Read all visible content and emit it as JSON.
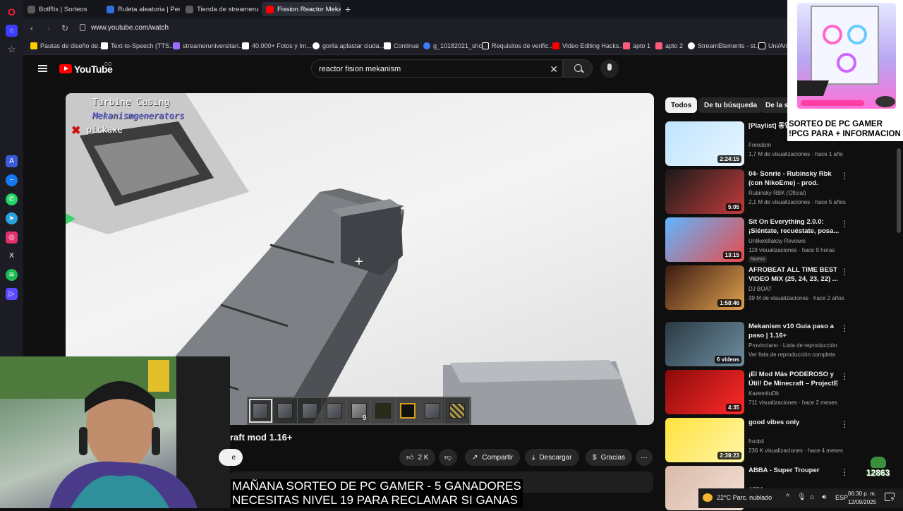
{
  "browser": {
    "tabs": [
      {
        "label": "BotRix | Sorteos",
        "color": "#5a5a5a"
      },
      {
        "label": "Ruleta aleatoria | Personal",
        "color": "#2f6fe0"
      },
      {
        "label": "Tienda de streameruniver",
        "color": "#5a5a5a"
      },
      {
        "label": "Fission Reactor Mekan",
        "color": "#ff0000"
      }
    ],
    "new_tab": "+",
    "url": "www.youtube.com/watch",
    "bookmarks": [
      {
        "label": "Pautas de diseño de...",
        "color": "#ffcc00"
      },
      {
        "label": "Text-to-Speech (TTS...",
        "color": "#ffffff"
      },
      {
        "label": "streameruniversitari...",
        "color": "#9b6bff"
      },
      {
        "label": "40.000+ Fotos y Im...",
        "color": "#ffffff"
      },
      {
        "label": "gorila aplastar ciuda...",
        "color": "#ffffff"
      },
      {
        "label": "Continue",
        "color": "#ffffff"
      },
      {
        "label": "g_10182021_shcc",
        "color": "#3d7bff"
      },
      {
        "label": "Requisitos de verific...",
        "color": "#ffffff"
      },
      {
        "label": "Video Editing Hacks...",
        "color": "#ff0000"
      },
      {
        "label": "apto 1",
        "color": "#ff5a7a"
      },
      {
        "label": "apto 2",
        "color": "#ff5a7a"
      },
      {
        "label": "StreamElements - st...",
        "color": "#ffffff"
      },
      {
        "label": "Uni/Ari",
        "color": "#ffffff"
      }
    ]
  },
  "youtube": {
    "logo_text": "YouTube",
    "country": "CO",
    "search_value": "reactor fision mekanism",
    "video_title": "raft mod 1.16+",
    "subscribe_label": "e",
    "actions": {
      "likes": "2 K",
      "share": "Compartir",
      "download": "Descargar",
      "thanks": "Gracias",
      "more": "···"
    },
    "chips": [
      "Todos",
      "De tu búsqueda",
      "De la se"
    ]
  },
  "game_overlay": {
    "title": "Turbine Casing",
    "subtitle": "Mekanismgenerators",
    "tool": "pickaxe",
    "hotbar_count": "9"
  },
  "recommendations": [
    {
      "title": "[Playlist] 동영 모음 2024 V",
      "channel": "Freedom",
      "meta": "1,7 M de visualizaciones · hace 1 año",
      "duration": "2:24:15",
      "color_a": "#bfe4ff",
      "color_b": "#e8f6ff"
    },
    {
      "title": "04- Sonrie - Rubinsky Rbk (con NikoEme) - prod. Nikoeme. ...",
      "channel": "Rubinsky RBK (Oficial)",
      "meta": "2,1 M de visualizaciones · hace 5 años",
      "duration": "5:05",
      "color_a": "#1a1a1a",
      "color_b": "#c23b3b"
    },
    {
      "title": "Sit On Everything 2.0.0: ¡Siéntate, recuéstate, posa... e...",
      "channel": "Unlikekillakay Reviews",
      "meta": "119 visualizaciones · hace 9 horas",
      "duration": "13:15",
      "badge": "Nuevo",
      "color_a": "#5fb6ff",
      "color_b": "#e84b4b"
    },
    {
      "title": "AFROBEAT ALL TIME BEST VIDEO MIX (25, 24, 23, 22) ...",
      "channel": "DJ BOAT",
      "meta": "39 M de visualizaciones · hace 2 años",
      "duration": "1:58:46",
      "color_a": "#3a1a10",
      "color_b": "#e0a050"
    },
    {
      "title": "Mekanism v10 Guia paso a paso | 1.16+",
      "channel": "Provinciano · Lista de reproducción",
      "meta": "Ver lista de reproducción completa",
      "duration": "6 videos",
      "color_a": "#2b3a44",
      "color_b": "#6d8ea0"
    },
    {
      "title": "¡El Mod Más PODEROSO y Útil! De Minecraft – ProjectE",
      "channel": "KazemitoDk",
      "meta": "711 visualizaciones · hace 2 meses",
      "duration": "4:35",
      "color_a": "#8a0a0a",
      "color_b": "#ff2a2a"
    },
    {
      "title": "good vibes only",
      "channel": "froobii",
      "meta": "236 K visualizaciones · hace 4 meses",
      "duration": "2:38:23",
      "color_a": "#ffe23d",
      "color_b": "#fff6a8"
    },
    {
      "title": "ABBA - Super Trouper",
      "channel": "ABBA",
      "meta": "",
      "duration": "",
      "color_a": "#d9b9a8",
      "color_b": "#f3e1d6"
    }
  ],
  "ad": {
    "line1": "SORTEO DE PC GAMER",
    "line2": "!PCG PARA + INFORMACION"
  },
  "stream_overlay": {
    "line1": "MAÑANA SORTEO DE PC GAMER - 5 GANADORES",
    "line2": "NECESITAS NIVEL 19 PARA RECLAMAR SI GANAS",
    "viewer_count": "12863"
  },
  "taskbar": {
    "weather": "22°C  Parc. nublado",
    "lang": "ESP",
    "time": "06:30 p. m.",
    "date": "12/09/2025",
    "notif": "9"
  }
}
